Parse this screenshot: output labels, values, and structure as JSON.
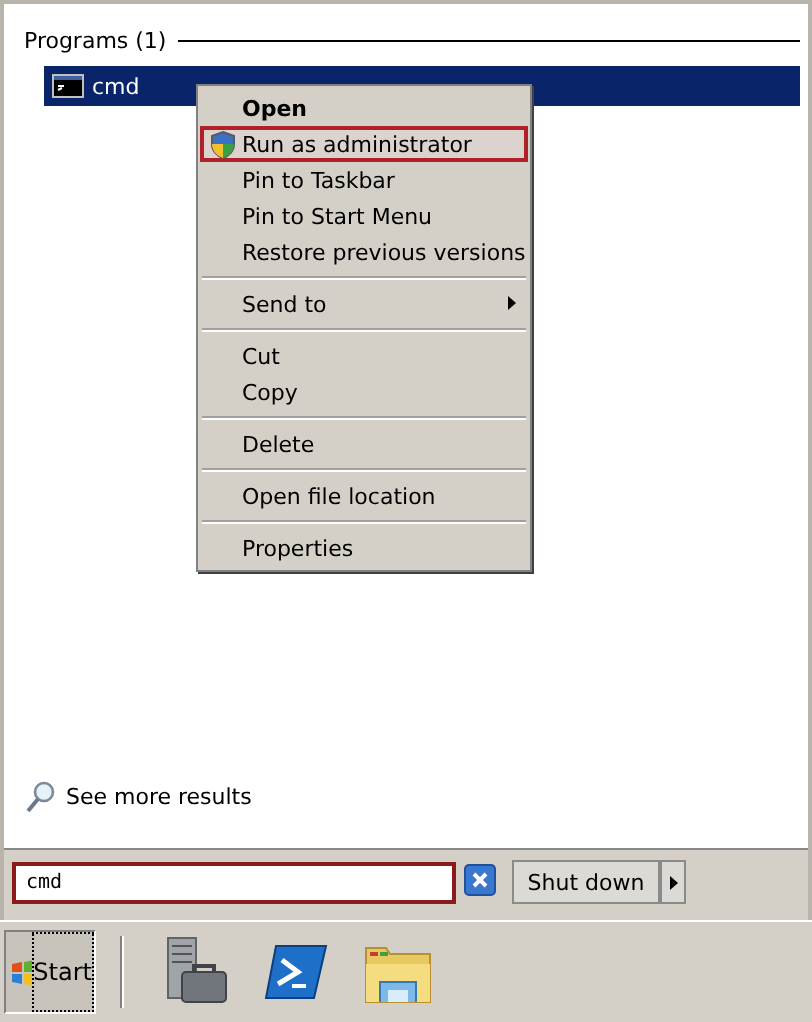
{
  "group": {
    "title": "Programs (1)"
  },
  "results": [
    {
      "label": "cmd",
      "selected": true
    }
  ],
  "context_menu": {
    "items": [
      {
        "kind": "default",
        "label": "Open",
        "selected": false
      },
      {
        "kind": "admin",
        "label": "Run as administrator",
        "selected": true
      },
      {
        "kind": "item",
        "label": "Pin to Taskbar",
        "selected": false
      },
      {
        "kind": "item",
        "label": "Pin to Start Menu",
        "selected": false
      },
      {
        "kind": "item",
        "label": "Restore previous versions",
        "selected": false
      },
      {
        "kind": "separator"
      },
      {
        "kind": "submenu",
        "label": "Send to",
        "selected": false
      },
      {
        "kind": "separator"
      },
      {
        "kind": "item",
        "label": "Cut",
        "selected": false
      },
      {
        "kind": "item",
        "label": "Copy",
        "selected": false
      },
      {
        "kind": "separator"
      },
      {
        "kind": "item",
        "label": "Delete",
        "selected": false
      },
      {
        "kind": "separator"
      },
      {
        "kind": "item",
        "label": "Open file location",
        "selected": false
      },
      {
        "kind": "separator"
      },
      {
        "kind": "item",
        "label": "Properties",
        "selected": false
      }
    ]
  },
  "see_more": {
    "label": "See more results"
  },
  "search": {
    "value": "cmd"
  },
  "shutdown": {
    "label": "Shut down"
  },
  "taskbar": {
    "start": "Start"
  }
}
